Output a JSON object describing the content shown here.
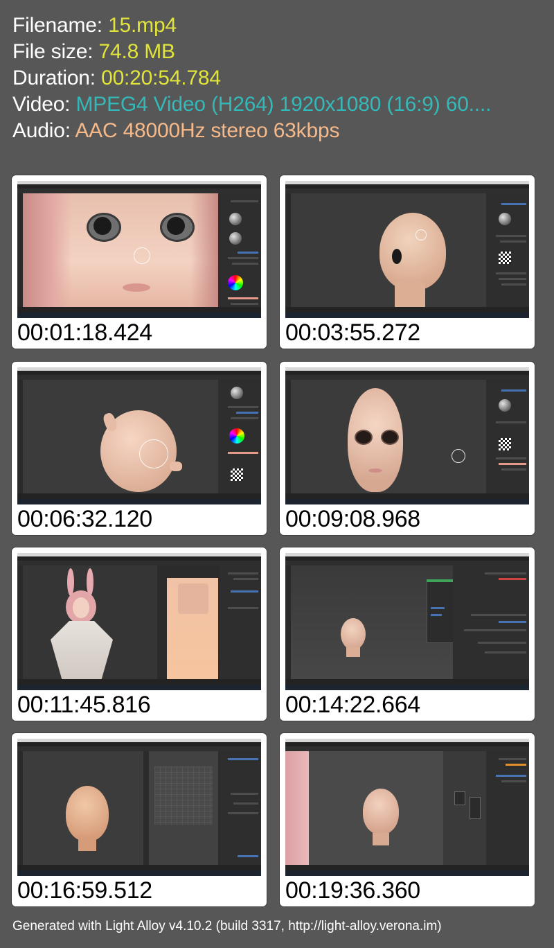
{
  "info": {
    "filename_label": "Filename: ",
    "filename_value": "15.mp4",
    "filesize_label": "File size: ",
    "filesize_value": "74.8 MB",
    "duration_label": "Duration: ",
    "duration_value": "00:20:54.784",
    "video_label": "Video: ",
    "video_value": "MPEG4 Video (H264) 1920x1080 (16:9) 60....",
    "audio_label": "Audio: ",
    "audio_value": "AAC 48000Hz stereo 63kbps"
  },
  "thumbnails": [
    {
      "timestamp": "00:01:18.424"
    },
    {
      "timestamp": "00:03:55.272"
    },
    {
      "timestamp": "00:06:32.120"
    },
    {
      "timestamp": "00:09:08.968"
    },
    {
      "timestamp": "00:11:45.816"
    },
    {
      "timestamp": "00:14:22.664"
    },
    {
      "timestamp": "00:16:59.512"
    },
    {
      "timestamp": "00:19:36.360"
    }
  ],
  "footer": "Generated with Light Alloy v4.10.2 (build 3317, http://light-alloy.verona.im)",
  "colors": {
    "background": "#575757",
    "filename_value": "#e1e43a",
    "video_value": "#35b8b8",
    "audio_value": "#f6b98a"
  }
}
